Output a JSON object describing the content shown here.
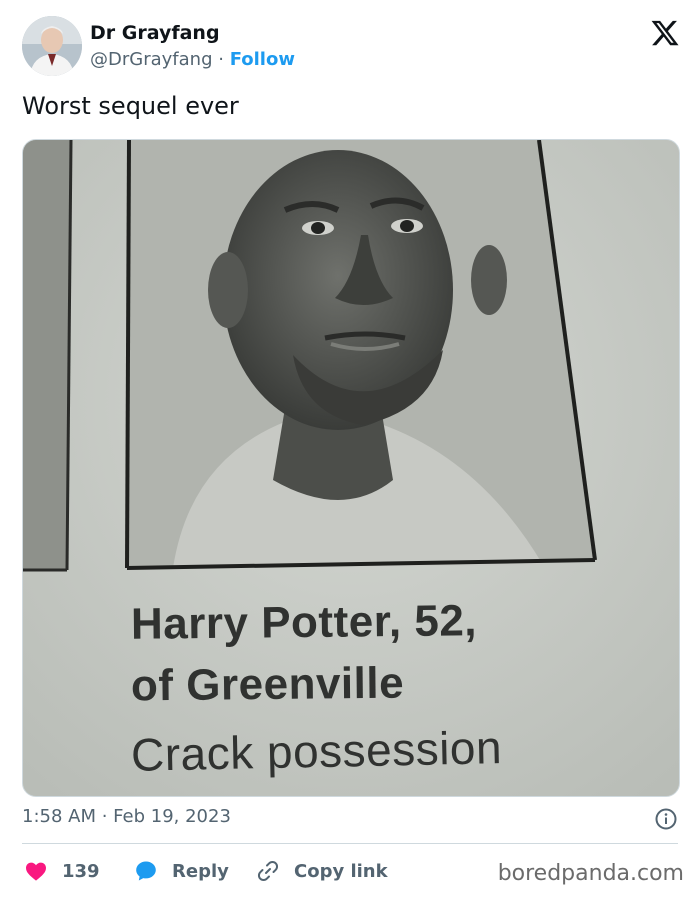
{
  "author": {
    "display_name": "Dr Grayfang",
    "handle": "@DrGrayfang",
    "separator": "·",
    "follow_label": "Follow",
    "avatar_icon": "avatar-photo"
  },
  "platform": {
    "logo_icon": "x-logo-icon"
  },
  "tweet": {
    "text": "Worst sequel ever",
    "media": {
      "caption_line1": "Harry Potter, 52,",
      "caption_line2": "of Greenville",
      "caption_line3": "Crack possession"
    },
    "timestamp": "1:58 AM · Feb 19, 2023"
  },
  "actions": {
    "like_count": "139",
    "reply_label": "Reply",
    "copy_link_label": "Copy link"
  },
  "watermark": "boredpanda.com",
  "colors": {
    "accent": "#1d9bf0",
    "like": "#f91880",
    "text_primary": "#0f1419",
    "text_secondary": "#536471"
  }
}
